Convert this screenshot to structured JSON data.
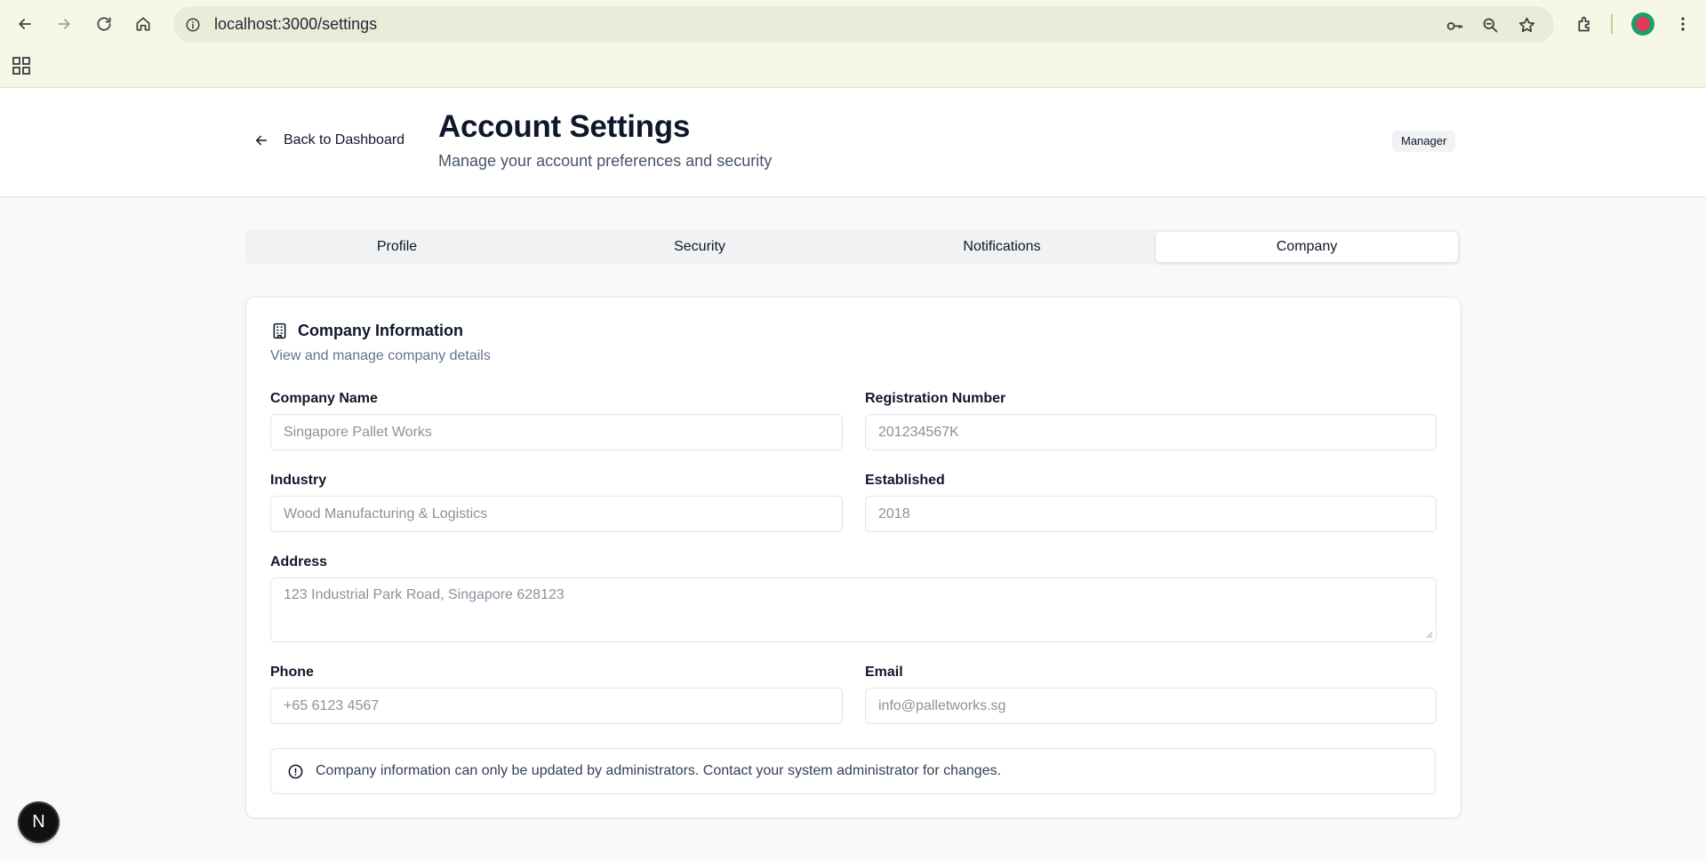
{
  "browser": {
    "url": "localhost:3000/settings"
  },
  "header": {
    "back_label": "Back to Dashboard",
    "title": "Account Settings",
    "subtitle": "Manage your account preferences and security",
    "role_badge": "Manager"
  },
  "tabs": [
    {
      "label": "Profile",
      "active": false
    },
    {
      "label": "Security",
      "active": false
    },
    {
      "label": "Notifications",
      "active": false
    },
    {
      "label": "Company",
      "active": true
    }
  ],
  "card": {
    "title": "Company Information",
    "description": "View and manage company details",
    "fields": {
      "company_name": {
        "label": "Company Name",
        "value": "Singapore Pallet Works"
      },
      "registration_number": {
        "label": "Registration Number",
        "value": "201234567K"
      },
      "industry": {
        "label": "Industry",
        "value": "Wood Manufacturing & Logistics"
      },
      "established": {
        "label": "Established",
        "value": "2018"
      },
      "address": {
        "label": "Address",
        "value": "123 Industrial Park Road, Singapore 628123"
      },
      "phone": {
        "label": "Phone",
        "value": "+65 6123 4567"
      },
      "email": {
        "label": "Email",
        "value": "info@palletworks.sg"
      }
    },
    "notice": "Company information can only be updated by administrators. Contact your system administrator for changes."
  },
  "dev_badge": {
    "letter": "N"
  },
  "colors": {
    "chrome_bg": "#f7f7e8",
    "page_bg": "#f8f9fb",
    "text_primary": "#0f172a",
    "text_muted": "#64748b",
    "border": "#e2e5ea"
  }
}
